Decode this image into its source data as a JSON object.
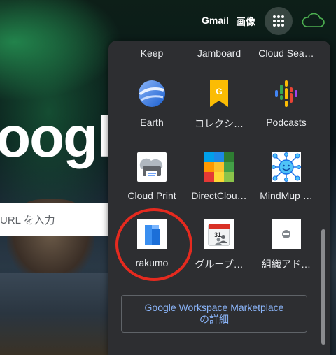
{
  "topbar": {
    "gmail": "Gmail",
    "images": "画像"
  },
  "background": {
    "logo_text": "oogl",
    "search_placeholder": "URL を入力"
  },
  "apps_panel": {
    "top_row": [
      {
        "label": "Keep"
      },
      {
        "label": "Jamboard"
      },
      {
        "label": "Cloud Sea…"
      }
    ],
    "row2": [
      {
        "label": "Earth",
        "icon": "earth-icon"
      },
      {
        "label": "コレクシ…",
        "icon": "collections-icon"
      },
      {
        "label": "Podcasts",
        "icon": "podcasts-icon"
      }
    ],
    "row3": [
      {
        "label": "Cloud Print",
        "icon": "cloud-print-icon"
      },
      {
        "label": "DirectClou…",
        "icon": "directcloud-icon"
      },
      {
        "label": "MindMup …",
        "icon": "mindmup-icon"
      }
    ],
    "row4": [
      {
        "label": "rakumo",
        "icon": "rakumo-icon"
      },
      {
        "label": "グループ…",
        "icon": "group-calendar-icon"
      },
      {
        "label": "組織アド…",
        "icon": "org-address-icon"
      }
    ],
    "marketplace_line1": "Google Workspace Marketplace",
    "marketplace_line2": "の詳細",
    "calendar_day": "31"
  },
  "colors": {
    "panel_bg": "#2d2e31",
    "link_blue": "#8ab4f8",
    "highlight_red": "#e52a1f"
  }
}
